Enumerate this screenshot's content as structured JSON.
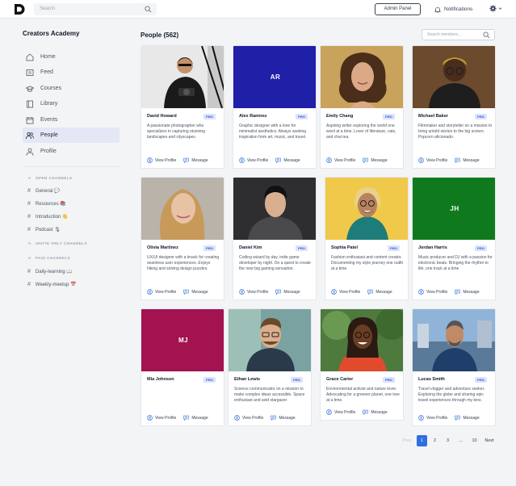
{
  "topbar": {
    "search_placeholder": "Search",
    "admin_label": "Admin Panel",
    "notifications_label": "Notifications"
  },
  "sidebar": {
    "title": "Creators Academy",
    "nav": [
      {
        "label": "Home",
        "icon": "home-icon"
      },
      {
        "label": "Feed",
        "icon": "feed-icon"
      },
      {
        "label": "Courses",
        "icon": "courses-icon"
      },
      {
        "label": "Library",
        "icon": "library-icon"
      },
      {
        "label": "Events",
        "icon": "calendar-icon"
      },
      {
        "label": "People",
        "icon": "people-icon",
        "active": true
      },
      {
        "label": "Profile",
        "icon": "user-icon"
      }
    ],
    "open_channels_label": "OPEN CHANNELS",
    "open_channels": [
      "General 💬",
      "Resources 📚",
      "Introduction 👋",
      "Podcast 🎙"
    ],
    "invite_channels_label": "INVITE ONLY CHANNELS",
    "paid_channels_label": "PAID CHANNELS",
    "paid_channels": [
      "Daily-learning 📖",
      "Weekly-meetup 📅"
    ]
  },
  "main": {
    "title": "People (562)",
    "member_search_placeholder": "Search members...",
    "view_profile_label": "View Profile",
    "message_label": "Message",
    "pro_label": "PRO",
    "people": [
      {
        "name": "David Howard",
        "bio": "A passionate photographer who specializes in capturing stunning landscapes and cityscapes.",
        "photo": true
      },
      {
        "name": "Alex Ramirez",
        "bio": "Graphic designer with a love for minimalist aesthetics. Always seeking inspiration from art, music, and travel.",
        "initials": "AR",
        "color": "#1f1fa8"
      },
      {
        "name": "Emily Chang",
        "bio": "Aspiring writer exploring the world one word at a time. Lover of literature, cats, and chai tea.",
        "photo": true
      },
      {
        "name": "Michael Baker",
        "bio": "Filmmaker and storyteller on a mission to bring untold stories to the big screen. Popcorn aficionado.",
        "photo": true
      },
      {
        "name": "Olivia Martinez",
        "bio": "UX/UI designer with a knack for creating seamless user experiences. Enjoys hiking and solving design puzzles.",
        "photo": true
      },
      {
        "name": "Daniel Kim",
        "bio": "Coding wizard by day, indie game developer by night. On a quest to create the next big gaming sensation.",
        "photo": true
      },
      {
        "name": "Sophia Patel",
        "bio": "Fashion enthusiast and content creator. Documenting my style journey one outfit at a time.",
        "photo": true
      },
      {
        "name": "Jordan Harris",
        "bio": "Music producer and DJ with a passion for electronic beats. Bringing the rhythm to life, one track at a time",
        "initials": "JH",
        "color": "#0f7a1d"
      },
      {
        "name": "Mia Johnson",
        "bio": "",
        "initials": "MJ",
        "color": "#a3134f"
      },
      {
        "name": "Ethan Lewis",
        "bio": "Science communicator on a mission to make complex ideas accessible. Space enthusiast and avid stargazer",
        "photo": true
      },
      {
        "name": "Grace Carter",
        "bio": "Environmental activist and nature lover. Advocating for a greener planet, one tree at a time.",
        "photo": true
      },
      {
        "name": "Lucas Smith",
        "bio": "Travel vlogger and adventure seeker. Exploring the globe and sharing epic travel experiences through my lens.",
        "photo": true
      }
    ]
  },
  "pagination": {
    "prev": "Prev",
    "pages": [
      "1",
      "2",
      "3",
      "...",
      "10"
    ],
    "next": "Next",
    "current": "1"
  },
  "colors": {
    "accent": "#2f6fe0",
    "pro_bg": "#dbe4ff",
    "pro_text": "#2f4fd6",
    "nav_active_bg": "#e4e7f5"
  }
}
